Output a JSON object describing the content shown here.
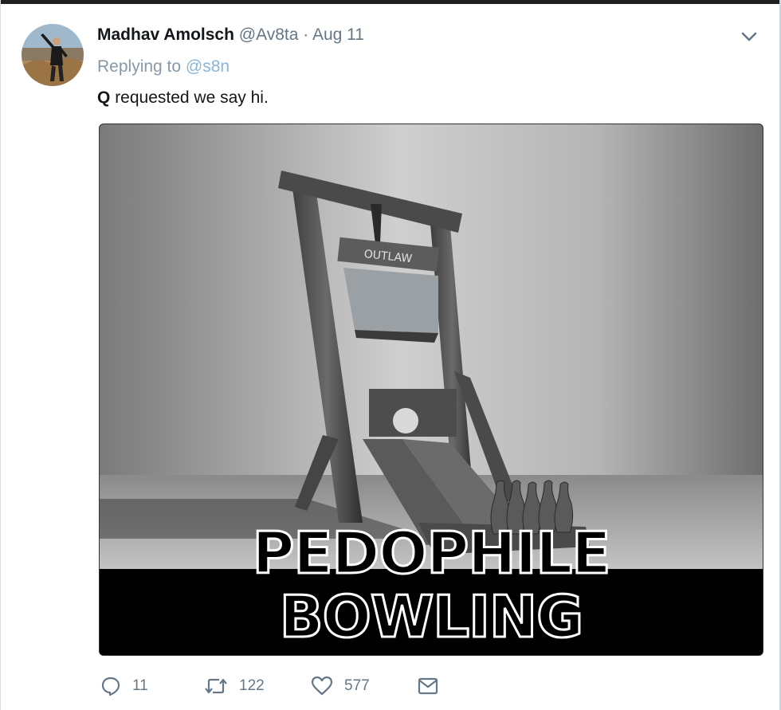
{
  "tweet": {
    "author_name": "Madhav Amolsch",
    "author_handle": "@Av8ta",
    "separator": "·",
    "date": "Aug 11",
    "reply_prefix": "Replying to",
    "reply_handle": "@s8n",
    "text_bold": "Q",
    "text_rest": "requested we say hi."
  },
  "media": {
    "sign_text": "OUTLAW",
    "caption": "PEDOPHILE BOWLING"
  },
  "actions": {
    "replies": "11",
    "retweets": "122",
    "likes": "577"
  },
  "icons": {
    "reply": "reply-icon",
    "retweet": "retweet-icon",
    "like": "heart-icon",
    "message": "envelope-icon",
    "menu": "chevron-down-icon"
  },
  "colors": {
    "text_primary": "#14171a",
    "text_secondary": "#657786",
    "handle_link": "#8ab4d6"
  }
}
